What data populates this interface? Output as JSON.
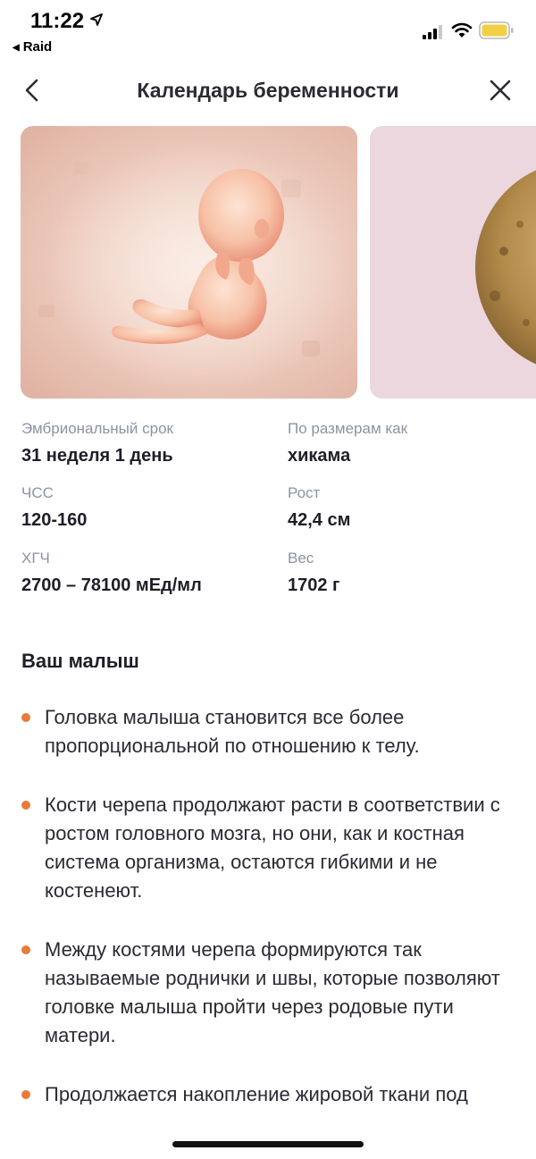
{
  "status_bar": {
    "time": "11:22",
    "back_app": "Raid",
    "icons": [
      "location-arrow-icon",
      "signal-icon",
      "wifi-icon",
      "battery-icon"
    ],
    "battery_color": "#f2d046"
  },
  "nav": {
    "title": "Календарь беременности",
    "back_icon": "chevron-left-icon",
    "close_icon": "close-icon"
  },
  "carousel": {
    "cards": [
      "fetus-illustration",
      "jicama-illustration"
    ],
    "colors": {
      "card1": "#ecc9bb",
      "card2": "#ecd7df"
    }
  },
  "stats": [
    {
      "label": "Эмбриональный срок",
      "value": "31 неделя 1 день"
    },
    {
      "label": "По размерам как",
      "value": "хикама"
    },
    {
      "label": "ЧСС",
      "value": "120-160"
    },
    {
      "label": "Рост",
      "value": "42,4 см"
    },
    {
      "label": "ХГЧ",
      "value": "2700 – 78100 мЕд/мл"
    },
    {
      "label": "Вес",
      "value": "1702 г"
    }
  ],
  "section": {
    "title": "Ваш малыш",
    "bullet_color": "#e97a3a",
    "items": [
      "Головка малыша становится все более пропорциональной по отношению к телу.",
      "Кости черепа продолжают расти в соответствии с ростом головного мозга, но они, как и костная система организма, остаются гибкими и не костенеют.",
      "Между костями черепа формируются так называемые роднички и швы, которые позволяют головке малыша пройти через родовые пути матери.",
      "Продолжается накопление жировой ткани под кожей, ручки и ножки постепенно"
    ]
  }
}
